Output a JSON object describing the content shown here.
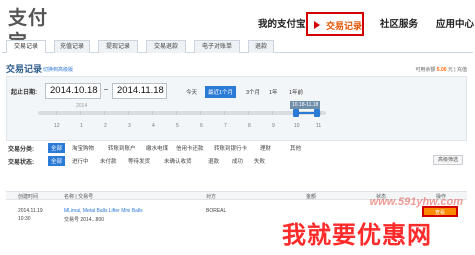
{
  "brand": {
    "logo": "支付宝"
  },
  "topnav": {
    "items": [
      "我的支付宝",
      "交易记录",
      "社区服务",
      "应用中心"
    ],
    "active": "交易记录"
  },
  "tabs": [
    "交易记录",
    "充值记录",
    "提现记录",
    "交易退款",
    "电子对账单",
    "退款"
  ],
  "section": {
    "title": "交易记录",
    "link": "切换到高级版",
    "balance_label": "可用余额",
    "balance": "5.00",
    "balance_suffix": "元 | 充值"
  },
  "filter": {
    "date_label": "起止日期:",
    "start": "2014.10.18",
    "end": "2014.11.18",
    "quick": [
      "今天",
      "最近1个月",
      "3个月",
      "1年",
      "1年前"
    ],
    "quick_selected": "最近1个月",
    "timeline_labels": [
      "12",
      "1",
      "2",
      "3",
      "4",
      "5",
      "6",
      "7",
      "8",
      "9",
      "10",
      "11"
    ],
    "year_label": "2014",
    "range_label": "10.18-11.18",
    "type_label": "交易分类:",
    "type_chips": [
      "全部",
      "淘宝购物",
      "转账到账户",
      "缴水电煤",
      "信用卡还款",
      "转账到银行卡",
      "理财",
      "其他"
    ],
    "status_label": "交易状态:",
    "status_chips": [
      "全部",
      "进行中",
      "未付款",
      "等待发货",
      "未确认收货",
      "退款",
      "成功",
      "失败"
    ],
    "more": "高级筛选"
  },
  "table": {
    "headers": [
      "创建时间",
      "名称 | 交易号",
      "对方",
      "金额",
      "状态",
      "操作"
    ],
    "rows": [
      {
        "date": "2014.11.19",
        "time": "10:30",
        "name": "MLimai, Metal Balls Lifter Mini Balls",
        "trade": "交易号 2014...800",
        "counterparty": "BOREAL",
        "action": "查看"
      }
    ]
  },
  "watermark": "www.591yhw.com",
  "banner": "我就要优惠网"
}
